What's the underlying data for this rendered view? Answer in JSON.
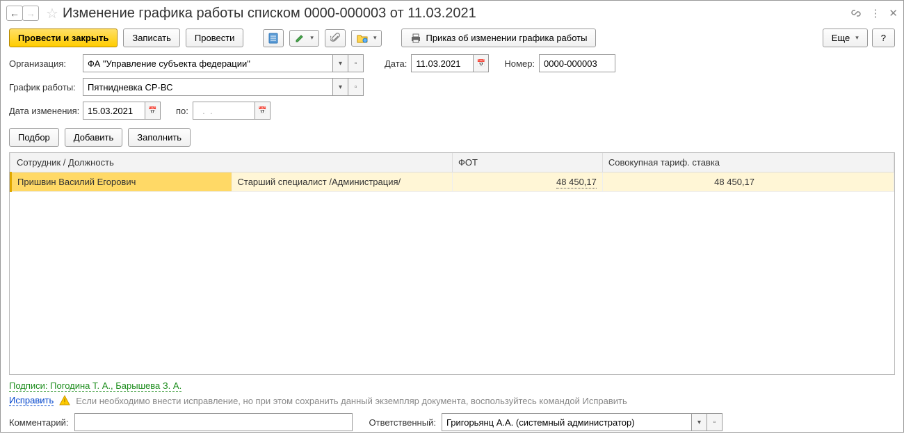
{
  "title": "Изменение графика работы списком 0000-000003 от 11.03.2021",
  "toolbar": {
    "post_and_close": "Провести и закрыть",
    "write": "Записать",
    "post": "Провести",
    "print_order": "Приказ об изменении графика работы",
    "more": "Еще",
    "help": "?"
  },
  "labels": {
    "organization": "Организация:",
    "date": "Дата:",
    "number": "Номер:",
    "schedule": "График работы:",
    "change_date": "Дата изменения:",
    "to": "по:",
    "comment": "Комментарий:",
    "responsible": "Ответственный:"
  },
  "fields": {
    "organization": "ФА \"Управление субъекта федерации\"",
    "date": "11.03.2021",
    "number": "0000-000003",
    "schedule": "Пятнидневка СР-ВС",
    "change_date": "15.03.2021",
    "to_date": "  .  .    ",
    "comment": "",
    "responsible": "Григорьянц А.А. (системный администратор)"
  },
  "buttons": {
    "select": "Подбор",
    "add": "Добавить",
    "fill": "Заполнить"
  },
  "table": {
    "headers": {
      "employee": "Сотрудник / Должность",
      "fot": "ФОТ",
      "rate": "Совокупная тариф. ставка"
    },
    "rows": [
      {
        "employee": "Пришвин Василий Егорович",
        "position": "Старший специалист /Администрация/",
        "fot": "48 450,17",
        "rate": "48 450,17"
      }
    ]
  },
  "signatures": "Подписи: Погодина Т. А., Барышева З. А.",
  "fix": {
    "link": "Исправить",
    "text": "Если необходимо внести исправление, но при этом сохранить данный экземпляр документа, воспользуйтесь командой Исправить"
  }
}
